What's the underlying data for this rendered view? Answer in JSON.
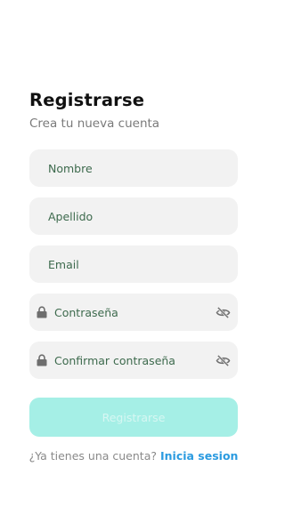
{
  "header": {
    "title": "Registrarse",
    "subtitle": "Crea tu nueva cuenta"
  },
  "form": {
    "fields": [
      {
        "placeholder": "Nombre",
        "value": ""
      },
      {
        "placeholder": "Apellido",
        "value": ""
      },
      {
        "placeholder": "Email",
        "value": ""
      },
      {
        "placeholder": "Contraseña",
        "value": "",
        "leading_icon": "lock-icon",
        "trailing_icon": "eye-off-icon"
      },
      {
        "placeholder": "Confirmar contraseña",
        "value": "",
        "leading_icon": "lock-icon",
        "trailing_icon": "eye-off-icon"
      }
    ],
    "submit_label": "Registrarse",
    "submit_enabled": false
  },
  "footer": {
    "question": "¿Ya tienes una cuenta?",
    "link_label": "Inicia sesion"
  },
  "colors": {
    "title": "#111111",
    "subtitle": "#7a7a7a",
    "field_background": "#f2f2f2",
    "placeholder_text": "#3d6a4d",
    "icon": "#6e6e6e",
    "submit_background": "#a5efe6",
    "submit_text": "#d7f7f3",
    "link": "#2b9be0"
  }
}
